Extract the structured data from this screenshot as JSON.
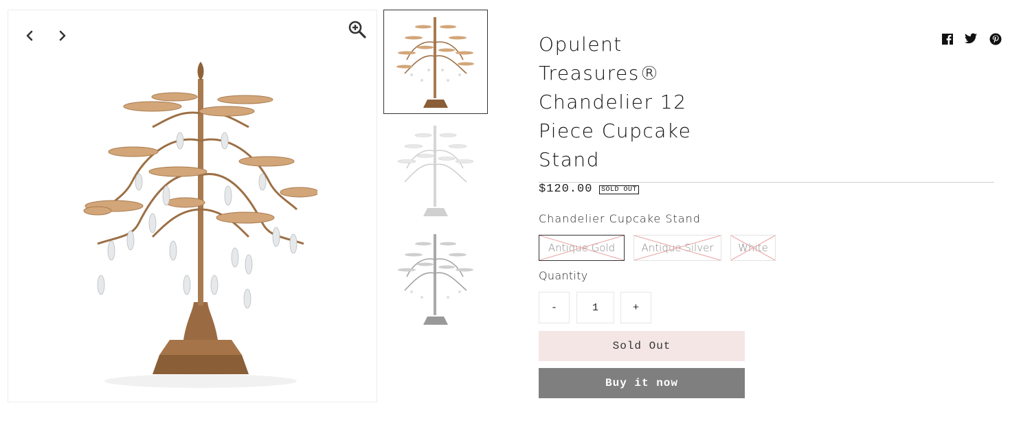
{
  "gallery": {
    "prev_icon": "chevron-left-icon",
    "next_icon": "chevron-right-icon",
    "zoom_icon": "zoom-in-icon",
    "thumbnails": [
      {
        "variant": "Antique Gold",
        "active": true
      },
      {
        "variant": "White",
        "active": false
      },
      {
        "variant": "Antique Silver",
        "active": false
      }
    ]
  },
  "product": {
    "title": "Opulent Treasures® Chandelier 12 Piece Cupcake Stand",
    "price": "$120.00",
    "sold_badge": "SOLD OUT",
    "option_name": "Chandelier Cupcake Stand",
    "options": [
      {
        "label": "Antique Gold",
        "selected": true,
        "unavailable": true
      },
      {
        "label": "Antique Silver",
        "selected": false,
        "unavailable": true
      },
      {
        "label": "White",
        "selected": false,
        "unavailable": true
      }
    ],
    "quantity_label": "Quantity",
    "quantity": "1",
    "minus": "-",
    "plus": "+",
    "sold_out_button": "Sold Out",
    "buy_now_button": "Buy it now"
  },
  "share": {
    "icons": [
      "facebook-icon",
      "twitter-icon",
      "pinterest-icon"
    ]
  },
  "colors": {
    "sold_out_bg": "#f5e6e6",
    "buy_now_bg": "#7f7f7f",
    "unavailable_cross": "#e8a0a0",
    "gold": "#b98c5e",
    "silver": "#d4d4d4"
  }
}
